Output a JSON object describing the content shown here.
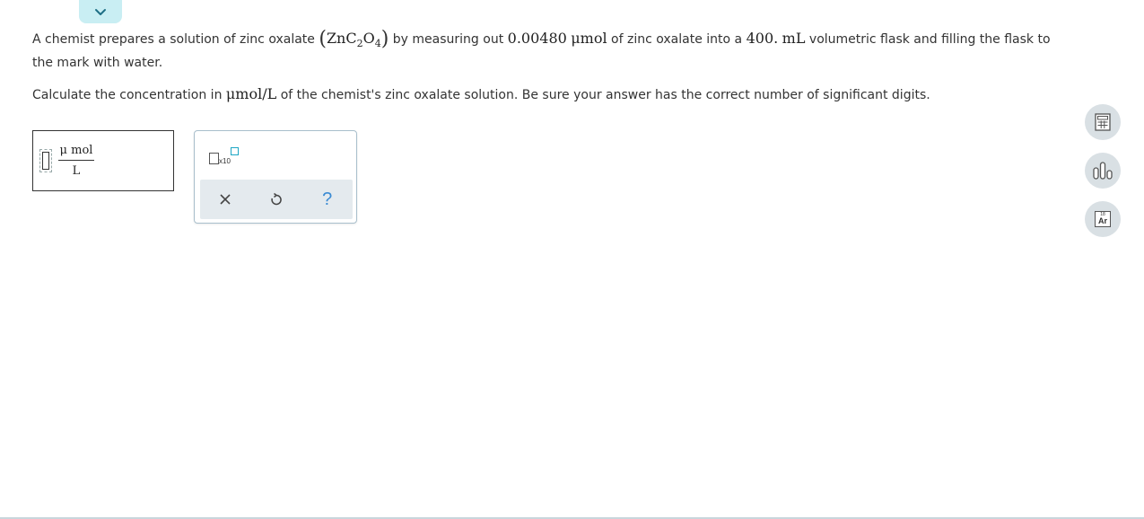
{
  "collapse_button": {
    "icon": "chevron-down-icon"
  },
  "question": {
    "p1_a": "A chemist prepares a solution of zinc oxalate",
    "formula_zn": "ZnC",
    "formula_sub1": "2",
    "formula_o": "O",
    "formula_sub2": "4",
    "p1_b": "by measuring out",
    "amount_value": "0.00480",
    "amount_unit": "μmol",
    "p1_c": "of zinc oxalate into a",
    "volume_value": "400.",
    "volume_unit": "mL",
    "p1_d": "volumetric flask and filling the flask to the mark with water.",
    "p2_a": "Calculate the concentration in",
    "conc_unit": "μmol/L",
    "p2_b": "of the chemist's zinc oxalate solution. Be sure your answer has the correct number of significant digits."
  },
  "answer": {
    "value": "",
    "unit_numerator": "μ mol",
    "unit_denominator": "L"
  },
  "toolbox": {
    "sci_notation_label": "x10",
    "clear_icon": "close-icon",
    "undo_icon": "undo-icon",
    "help_label": "?"
  },
  "side_tools": {
    "calculator_icon": "calculator-icon",
    "data_icon": "bar-chart-icon",
    "periodic_table_number": "18",
    "periodic_table_symbol": "Ar"
  },
  "colors": {
    "accent": "#1da6c4",
    "tab_bg": "#c9eef3",
    "tool_row_bg": "#e4eaee",
    "side_btn_bg": "#d9e0e4",
    "help": "#3a8bd3"
  }
}
